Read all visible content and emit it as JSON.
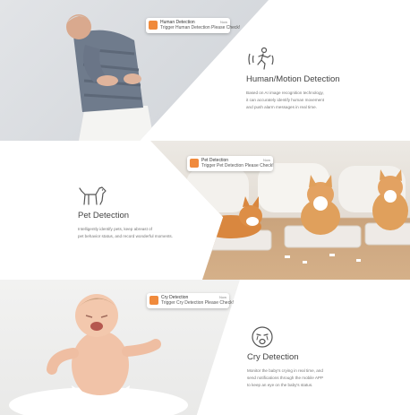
{
  "sections": [
    {
      "notification": {
        "title": "Human Detection",
        "body": "Trigger Human Detection Please Check!",
        "time": "Now"
      },
      "feature": {
        "icon": "running-person-icon",
        "title": "Human/Motion Detection",
        "description_lines": [
          "Based on AI image recognition technology,",
          "it can accurately identify human movement",
          "and push alarm messages in real time."
        ]
      }
    },
    {
      "notification": {
        "title": "Pet Detection",
        "body": "Trigger Pet Detection Please Check!",
        "time": "Now"
      },
      "feature": {
        "icon": "dog-icon",
        "title": "Pet Detection",
        "description_lines": [
          "Intelligently identify pets, keep abreast of",
          "pet behavior status, and record wonderful moments."
        ]
      }
    },
    {
      "notification": {
        "title": "Cry Detection",
        "body": "Trigger Cry Detection Please Check!",
        "time": "Now"
      },
      "feature": {
        "icon": "crying-face-icon",
        "title": "Cry Detection",
        "description_lines": [
          "Monitor the baby's crying in real time, and",
          "send notifications through the mobile APP",
          "to keep an eye on the baby's status."
        ]
      }
    }
  ],
  "colors": {
    "notification_icon": "#f08a3c",
    "title_text": "#444444",
    "description_text": "#777777"
  }
}
